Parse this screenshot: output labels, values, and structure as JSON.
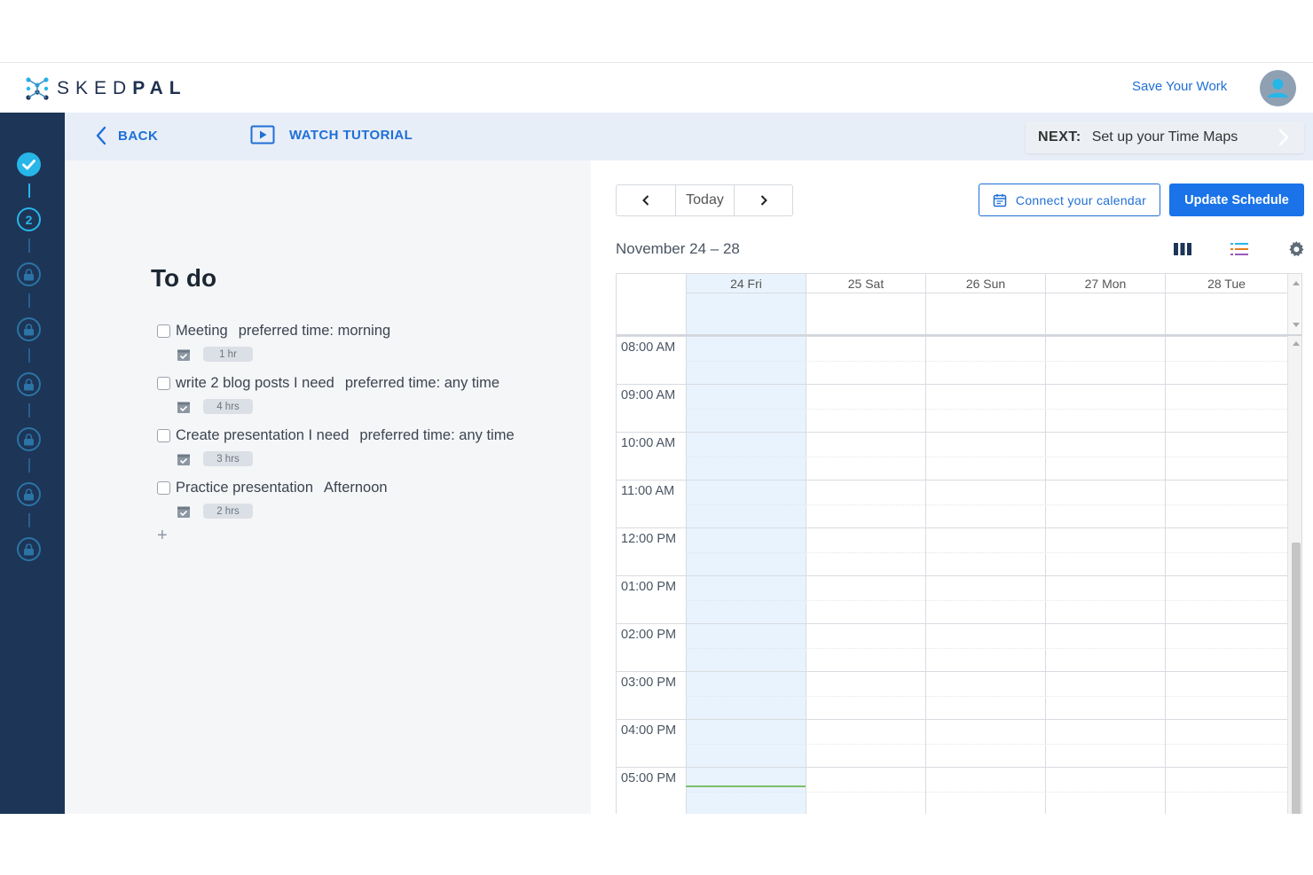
{
  "app": {
    "logo_text_light": "SKED",
    "logo_text_bold": "PAL",
    "save_work_label": "Save Your Work"
  },
  "colors": {
    "sidebar": "#1d3557",
    "accent": "#1a73e8",
    "step_active": "#27b6e8"
  },
  "sidebar": {
    "steps": [
      {
        "state": "done",
        "icon": "check-icon"
      },
      {
        "state": "current",
        "label": "2"
      },
      {
        "state": "locked",
        "icon": "lock-icon"
      },
      {
        "state": "locked",
        "icon": "lock-icon"
      },
      {
        "state": "locked",
        "icon": "lock-icon"
      },
      {
        "state": "locked",
        "icon": "lock-icon"
      },
      {
        "state": "locked",
        "icon": "lock-icon"
      },
      {
        "state": "locked",
        "icon": "lock-icon"
      }
    ]
  },
  "subnav": {
    "back_label": "BACK",
    "tutorial_label": "WATCH TUTORIAL",
    "next_prefix": "NEXT:",
    "next_label": "Set up your Time Maps"
  },
  "todo": {
    "title": "To do",
    "tasks": [
      {
        "name": "Meeting",
        "pref": "preferred time:  morning",
        "duration": "1 hr"
      },
      {
        "name": "write 2 blog posts I need",
        "pref": "preferred time: any time",
        "duration": "4 hrs"
      },
      {
        "name": "Create presentation I need",
        "pref": "preferred time: any time",
        "duration": "3 hrs"
      },
      {
        "name": "Practice presentation",
        "pref": "Afternoon",
        "duration": "2 hrs"
      }
    ],
    "add_label": "+"
  },
  "calendar": {
    "today_label": "Today",
    "connect_label": "Connect your calendar",
    "update_label": "Update Schedule",
    "date_range": "November 24 – 28",
    "days": [
      "24 Fri",
      "25 Sat",
      "26 Sun",
      "27 Mon",
      "28 Tue"
    ],
    "today_index": 0,
    "times": [
      "08:00 AM",
      "09:00 AM",
      "10:00 AM",
      "11:00 AM",
      "12:00 PM",
      "01:00 PM",
      "02:00 PM",
      "03:00 PM",
      "04:00 PM",
      "05:00 PM"
    ]
  }
}
